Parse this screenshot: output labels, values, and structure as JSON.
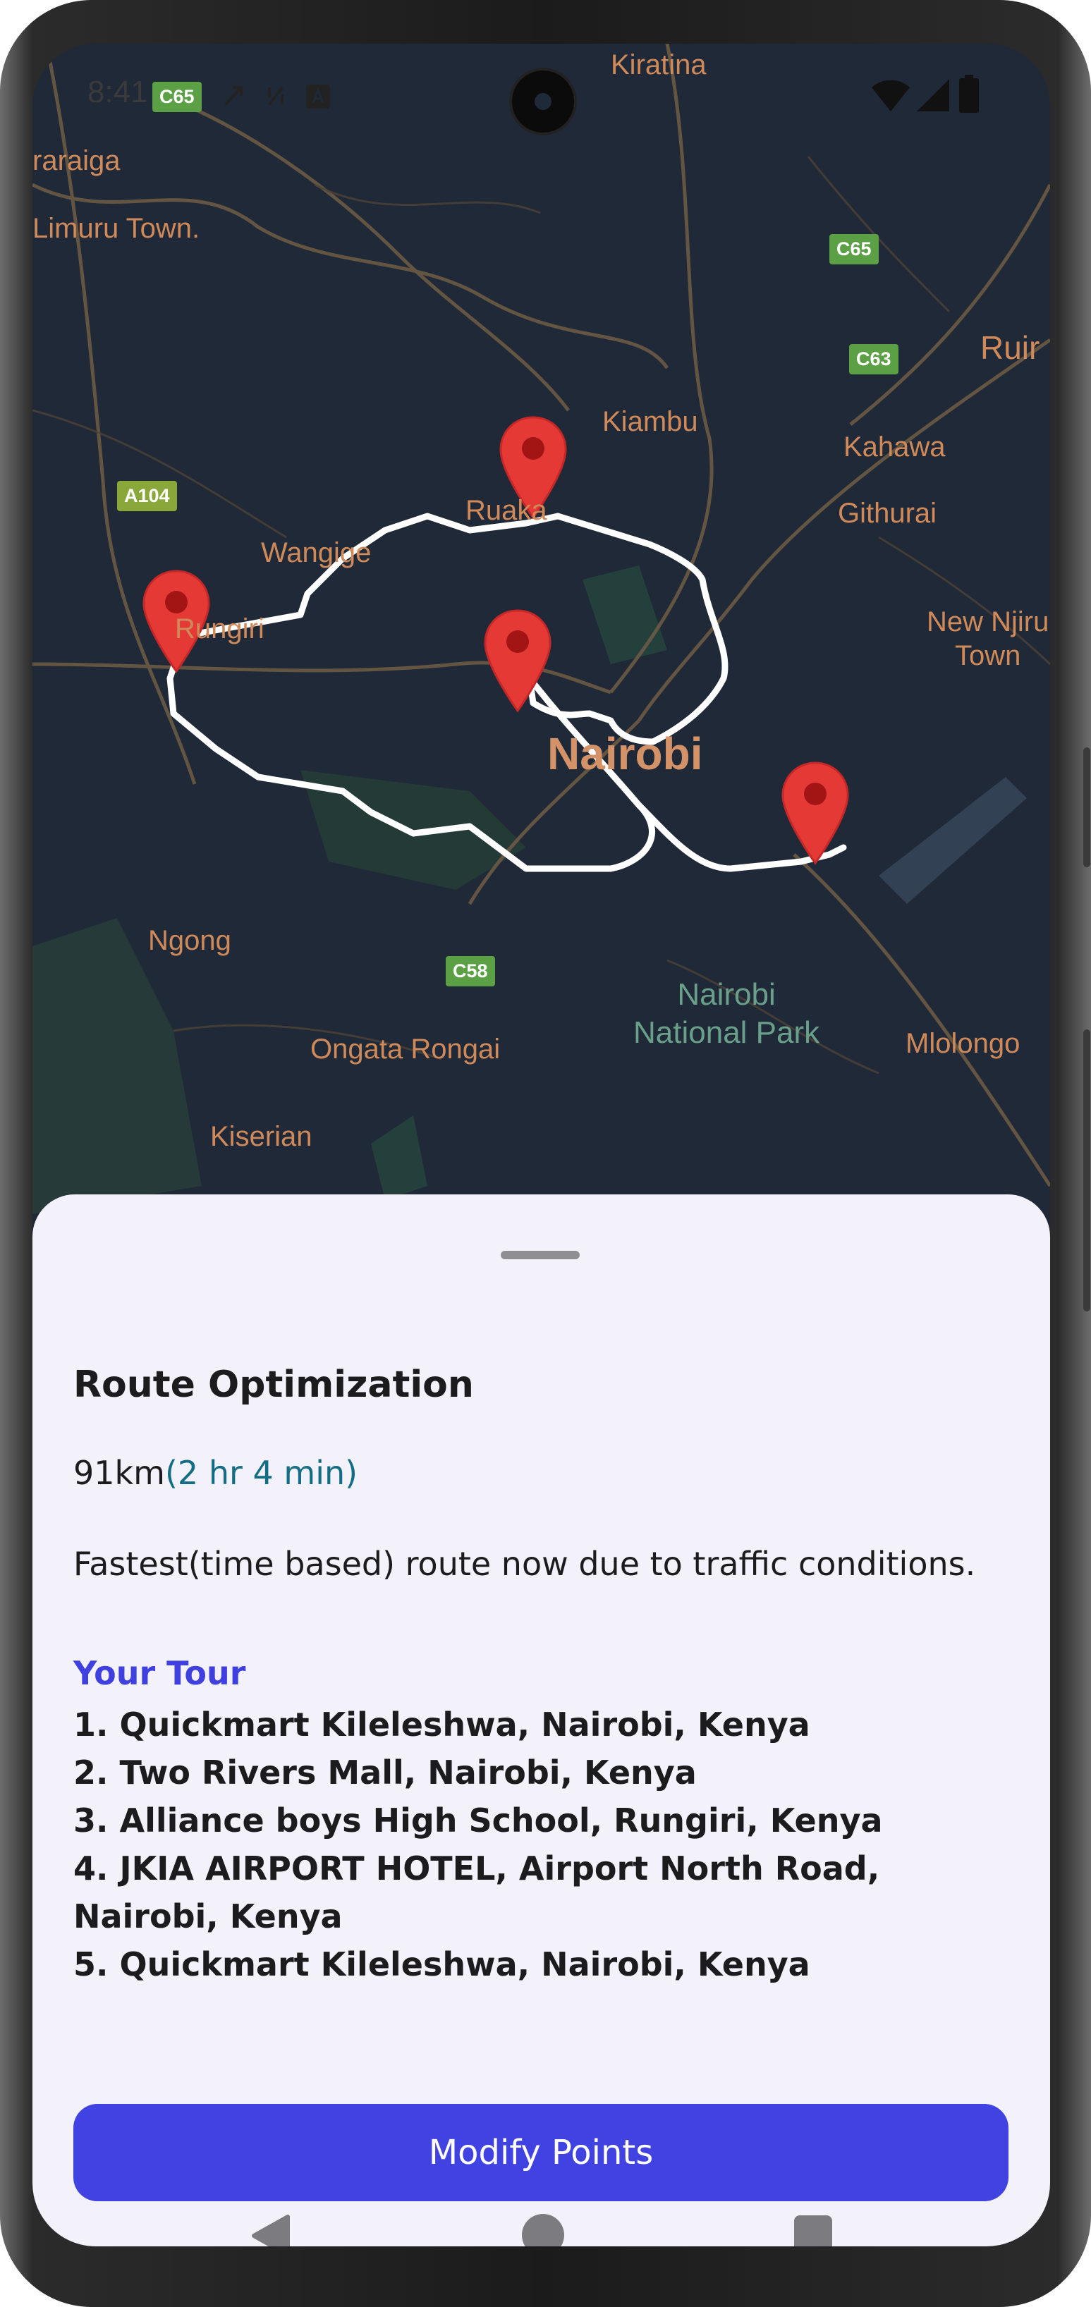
{
  "status_bar": {
    "time": "8:41"
  },
  "map": {
    "labels": {
      "kiratina": "Kiratina",
      "raraiga": "raraiga",
      "limuru": "Limuru Town.",
      "kiambu": "Kiambu",
      "kahawa": "Kahawa",
      "githurai": "Githurai",
      "ruaka": "Ruaka",
      "wangige": "Wangige",
      "rungiri": "Rungiri",
      "new_njiru": "New Njiru\nTown",
      "nairobi": "Nairobi",
      "ngong": "Ngong",
      "ongata": "Ongata Rongai",
      "kiserian": "Kiserian",
      "park": "Nairobi\nNational Park",
      "mlolongo": "Mlolongo",
      "ruiru": "Ruir"
    },
    "shields": {
      "c65_top": "C65",
      "c65": "C65",
      "c63": "C63",
      "a104": "A104",
      "c58": "C58"
    },
    "route_color": "#ffffff",
    "pin_color": "#e53935"
  },
  "sheet": {
    "title": "Route Optimization",
    "distance": "91km",
    "duration": "(2 hr 4 min)",
    "description": "Fastest(time based) route now due to traffic conditions.",
    "tour_title": "Your Tour",
    "tour": [
      "1. Quickmart Kileleshwa, Nairobi, Kenya",
      "2. Two Rivers Mall, Nairobi, Kenya",
      "3. Alliance boys High School, Rungiri, Kenya",
      "4. JKIA AIRPORT HOTEL, Airport North Road, Nairobi, Kenya",
      "5. Quickmart Kileleshwa, Nairobi, Kenya"
    ],
    "modify_button": "Modify Points"
  },
  "colors": {
    "accent": "#4142e2",
    "duration": "#136d84",
    "sheet_bg": "#f3f1f9",
    "map_bg": "#1f2937"
  }
}
